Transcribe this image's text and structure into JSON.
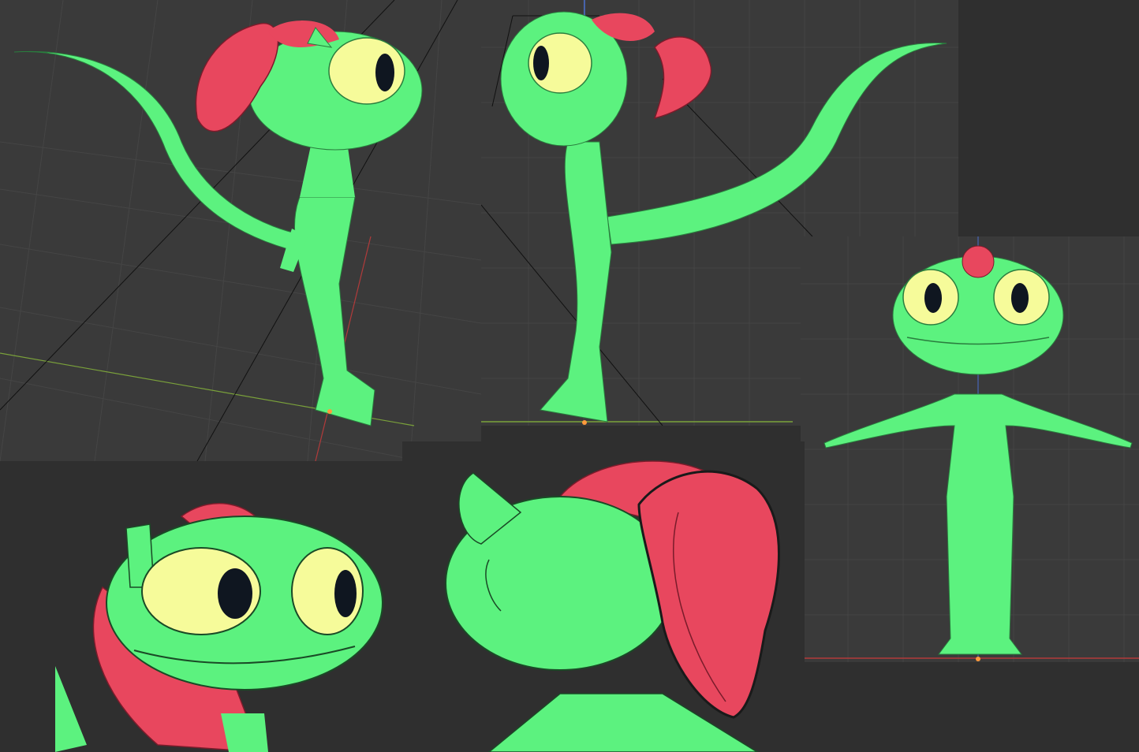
{
  "colors": {
    "background": "#2f2f2f",
    "viewport": "#3a3a3a",
    "grid": "#454545",
    "skin": "#5cf27f",
    "skin_shade": "#3fcf62",
    "hair": "#e8475e",
    "hair_shade": "#b82d44",
    "eye_white": "#f6fb9a",
    "pupil": "#0f1620",
    "axis_x": "#b13a3a",
    "axis_y": "#7aa13a"
  },
  "panels": [
    {
      "name": "perspective-side-view"
    },
    {
      "name": "orthographic-side-view"
    },
    {
      "name": "front-view-t-pose"
    },
    {
      "name": "face-closeup"
    },
    {
      "name": "head-back-closeup"
    }
  ]
}
